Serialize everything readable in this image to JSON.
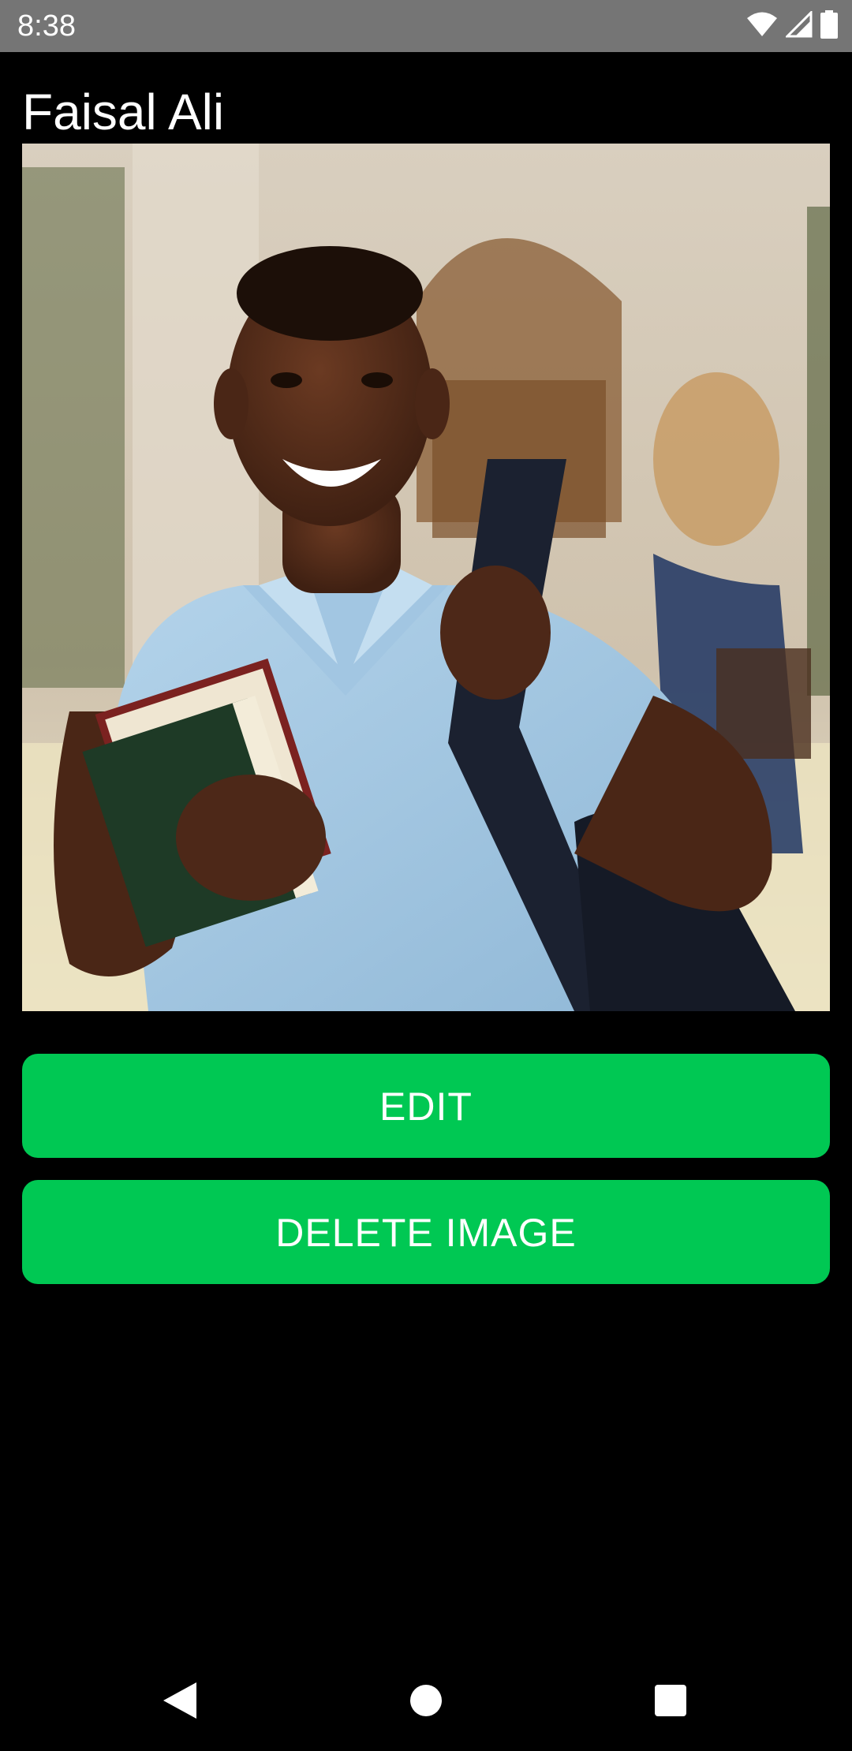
{
  "status_bar": {
    "time": "8:38",
    "icons": [
      "wifi-icon",
      "signal-icon",
      "battery-icon"
    ]
  },
  "contact": {
    "name": "Faisal Ali"
  },
  "photo": {
    "description_icon": "contact-photo"
  },
  "buttons": {
    "edit_label": "EDIT",
    "delete_label": "DELETE IMAGE"
  },
  "nav": {
    "back": "back-icon",
    "home": "home-icon",
    "recents": "recents-icon"
  },
  "colors": {
    "accent": "#00C853",
    "status_bar": "#757575",
    "background": "#000000",
    "text": "#FFFFFF"
  }
}
